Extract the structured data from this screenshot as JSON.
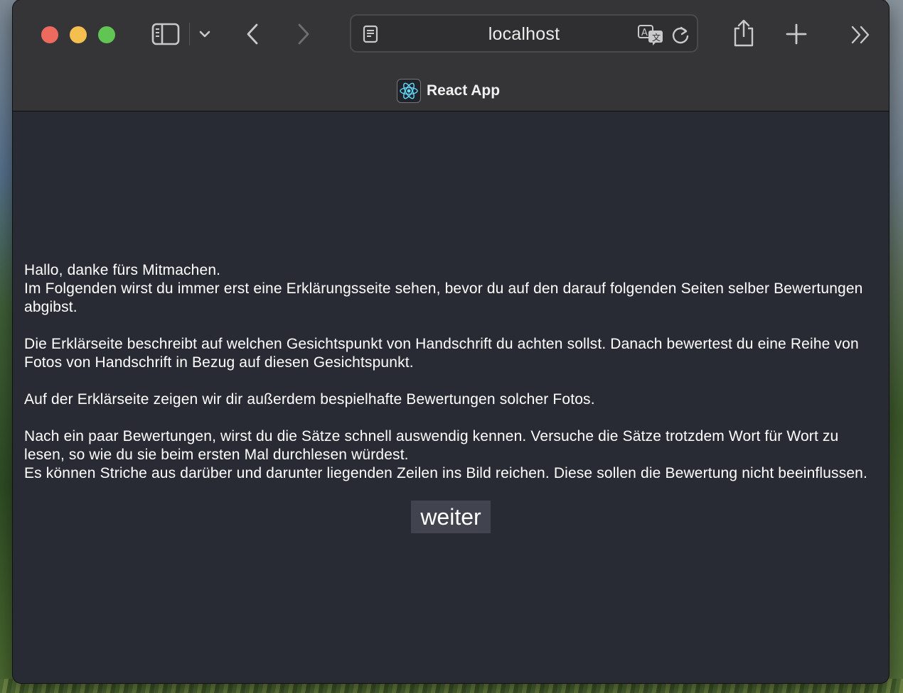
{
  "browser": {
    "url": "localhost",
    "tab_title": "React App"
  },
  "page": {
    "paragraphs": [
      "Hallo, danke fürs Mitmachen.",
      "Im Folgenden wirst du immer erst eine Erklärungsseite sehen, bevor du auf den darauf folgenden Seiten selber Bewertungen abgibst.",
      "Die Erklärseite beschreibt auf welchen Gesichtspunkt von Handschrift du achten sollst. Danach bewertest du eine Reihe von Fotos von Handschrift in Bezug auf diesen Gesichtspunkt.",
      "Auf der Erklärseite zeigen wir dir außerdem bespielhafte Bewertungen solcher Fotos.",
      "Nach ein paar Bewertungen, wirst du die Sätze schnell auswendig kennen. Versuche die Sätze trotzdem Wort für Wort zu lesen, so wie du sie beim ersten Mal durchlesen würdest.",
      "Es können Striche aus darüber und darunter liegenden Zeilen ins Bild reichen. Diese sollen die Bewertung nicht beeinflussen."
    ],
    "continue_label": "weiter"
  },
  "colors": {
    "content_bg": "#282b34",
    "button_bg": "#41444f",
    "react_logo": "#61dafb"
  }
}
